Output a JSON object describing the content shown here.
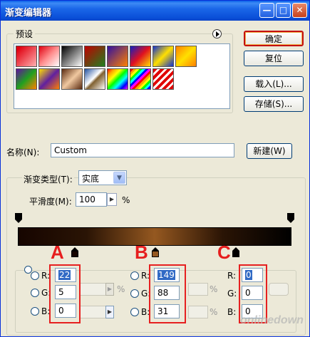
{
  "window": {
    "title": "渐变编辑器",
    "min_icon": "minimize-icon",
    "max_icon": "maximize-icon",
    "close_icon": "close-icon"
  },
  "presets": {
    "legend": "预设",
    "menu_icon": "circle-arrow-right-icon",
    "swatches": [
      "red-transparent",
      "red-checker",
      "black-white",
      "red-green",
      "violet-orange",
      "blue-red-yellow",
      "blue-yellow-blue",
      "orange-yellow-orange",
      "violet-green-orange",
      "yellow-violet-orange",
      "copper",
      "chrome",
      "spectrum",
      "transparent-rainbow",
      "transparent-stripes"
    ]
  },
  "buttons": {
    "ok": "确定",
    "reset": "复位",
    "load": "载入(L)...",
    "save": "存储(S)...",
    "new": "新建(W)"
  },
  "name": {
    "label": "名称(N):",
    "value": "Custom"
  },
  "gradient": {
    "type_label": "渐变类型(T):",
    "type_value": "实底",
    "smooth_label": "平滑度(M):",
    "smooth_value": "100",
    "smooth_unit": "%"
  },
  "markers": {
    "a": "A",
    "b": "B",
    "c": "C"
  },
  "color_a": {
    "r_label": "R:",
    "g_label": "G:",
    "b_label": "B:",
    "r": "22",
    "g": "5",
    "b": "0"
  },
  "color_b": {
    "r_label": "R:",
    "g_label": "G:",
    "b_label": "B:",
    "r": "149",
    "g": "88",
    "b": "31"
  },
  "color_c": {
    "r_label": "R:",
    "g_label": "G:",
    "b_label": "B:",
    "r": "0",
    "g": "0",
    "b": "0"
  },
  "percent_signs": {
    "a_opacity": "%",
    "b_opacity": "%",
    "b_location": "%"
  },
  "watermark": "onlinedown",
  "colors": {
    "stop_a": "#160500",
    "stop_b": "#955820",
    "stop_c": "#000000",
    "highlight_red": "#e62020"
  }
}
